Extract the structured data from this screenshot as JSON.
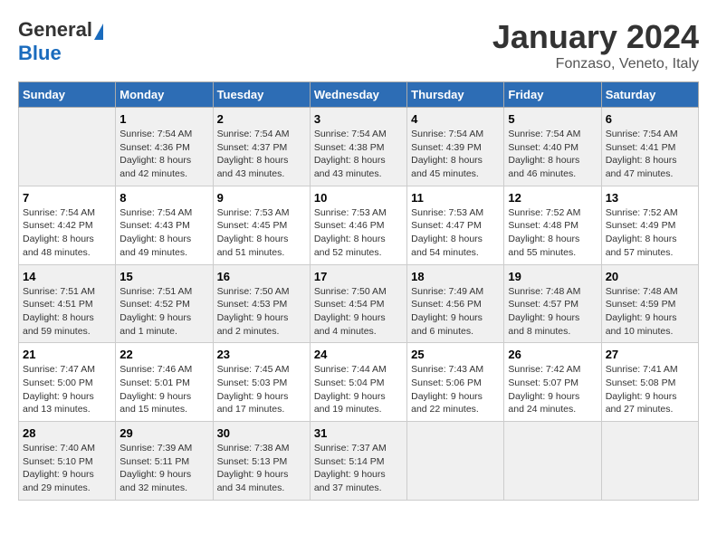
{
  "logo": {
    "general": "General",
    "blue": "Blue"
  },
  "title": "January 2024",
  "subtitle": "Fonzaso, Veneto, Italy",
  "days_of_week": [
    "Sunday",
    "Monday",
    "Tuesday",
    "Wednesday",
    "Thursday",
    "Friday",
    "Saturday"
  ],
  "weeks": [
    [
      {
        "day": null,
        "info": null
      },
      {
        "day": "1",
        "info": "Sunrise: 7:54 AM\nSunset: 4:36 PM\nDaylight: 8 hours\nand 42 minutes."
      },
      {
        "day": "2",
        "info": "Sunrise: 7:54 AM\nSunset: 4:37 PM\nDaylight: 8 hours\nand 43 minutes."
      },
      {
        "day": "3",
        "info": "Sunrise: 7:54 AM\nSunset: 4:38 PM\nDaylight: 8 hours\nand 43 minutes."
      },
      {
        "day": "4",
        "info": "Sunrise: 7:54 AM\nSunset: 4:39 PM\nDaylight: 8 hours\nand 45 minutes."
      },
      {
        "day": "5",
        "info": "Sunrise: 7:54 AM\nSunset: 4:40 PM\nDaylight: 8 hours\nand 46 minutes."
      },
      {
        "day": "6",
        "info": "Sunrise: 7:54 AM\nSunset: 4:41 PM\nDaylight: 8 hours\nand 47 minutes."
      }
    ],
    [
      {
        "day": "7",
        "info": "Sunrise: 7:54 AM\nSunset: 4:42 PM\nDaylight: 8 hours\nand 48 minutes."
      },
      {
        "day": "8",
        "info": "Sunrise: 7:54 AM\nSunset: 4:43 PM\nDaylight: 8 hours\nand 49 minutes."
      },
      {
        "day": "9",
        "info": "Sunrise: 7:53 AM\nSunset: 4:45 PM\nDaylight: 8 hours\nand 51 minutes."
      },
      {
        "day": "10",
        "info": "Sunrise: 7:53 AM\nSunset: 4:46 PM\nDaylight: 8 hours\nand 52 minutes."
      },
      {
        "day": "11",
        "info": "Sunrise: 7:53 AM\nSunset: 4:47 PM\nDaylight: 8 hours\nand 54 minutes."
      },
      {
        "day": "12",
        "info": "Sunrise: 7:52 AM\nSunset: 4:48 PM\nDaylight: 8 hours\nand 55 minutes."
      },
      {
        "day": "13",
        "info": "Sunrise: 7:52 AM\nSunset: 4:49 PM\nDaylight: 8 hours\nand 57 minutes."
      }
    ],
    [
      {
        "day": "14",
        "info": "Sunrise: 7:51 AM\nSunset: 4:51 PM\nDaylight: 8 hours\nand 59 minutes."
      },
      {
        "day": "15",
        "info": "Sunrise: 7:51 AM\nSunset: 4:52 PM\nDaylight: 9 hours\nand 1 minute."
      },
      {
        "day": "16",
        "info": "Sunrise: 7:50 AM\nSunset: 4:53 PM\nDaylight: 9 hours\nand 2 minutes."
      },
      {
        "day": "17",
        "info": "Sunrise: 7:50 AM\nSunset: 4:54 PM\nDaylight: 9 hours\nand 4 minutes."
      },
      {
        "day": "18",
        "info": "Sunrise: 7:49 AM\nSunset: 4:56 PM\nDaylight: 9 hours\nand 6 minutes."
      },
      {
        "day": "19",
        "info": "Sunrise: 7:48 AM\nSunset: 4:57 PM\nDaylight: 9 hours\nand 8 minutes."
      },
      {
        "day": "20",
        "info": "Sunrise: 7:48 AM\nSunset: 4:59 PM\nDaylight: 9 hours\nand 10 minutes."
      }
    ],
    [
      {
        "day": "21",
        "info": "Sunrise: 7:47 AM\nSunset: 5:00 PM\nDaylight: 9 hours\nand 13 minutes."
      },
      {
        "day": "22",
        "info": "Sunrise: 7:46 AM\nSunset: 5:01 PM\nDaylight: 9 hours\nand 15 minutes."
      },
      {
        "day": "23",
        "info": "Sunrise: 7:45 AM\nSunset: 5:03 PM\nDaylight: 9 hours\nand 17 minutes."
      },
      {
        "day": "24",
        "info": "Sunrise: 7:44 AM\nSunset: 5:04 PM\nDaylight: 9 hours\nand 19 minutes."
      },
      {
        "day": "25",
        "info": "Sunrise: 7:43 AM\nSunset: 5:06 PM\nDaylight: 9 hours\nand 22 minutes."
      },
      {
        "day": "26",
        "info": "Sunrise: 7:42 AM\nSunset: 5:07 PM\nDaylight: 9 hours\nand 24 minutes."
      },
      {
        "day": "27",
        "info": "Sunrise: 7:41 AM\nSunset: 5:08 PM\nDaylight: 9 hours\nand 27 minutes."
      }
    ],
    [
      {
        "day": "28",
        "info": "Sunrise: 7:40 AM\nSunset: 5:10 PM\nDaylight: 9 hours\nand 29 minutes."
      },
      {
        "day": "29",
        "info": "Sunrise: 7:39 AM\nSunset: 5:11 PM\nDaylight: 9 hours\nand 32 minutes."
      },
      {
        "day": "30",
        "info": "Sunrise: 7:38 AM\nSunset: 5:13 PM\nDaylight: 9 hours\nand 34 minutes."
      },
      {
        "day": "31",
        "info": "Sunrise: 7:37 AM\nSunset: 5:14 PM\nDaylight: 9 hours\nand 37 minutes."
      },
      {
        "day": null,
        "info": null
      },
      {
        "day": null,
        "info": null
      },
      {
        "day": null,
        "info": null
      }
    ]
  ]
}
